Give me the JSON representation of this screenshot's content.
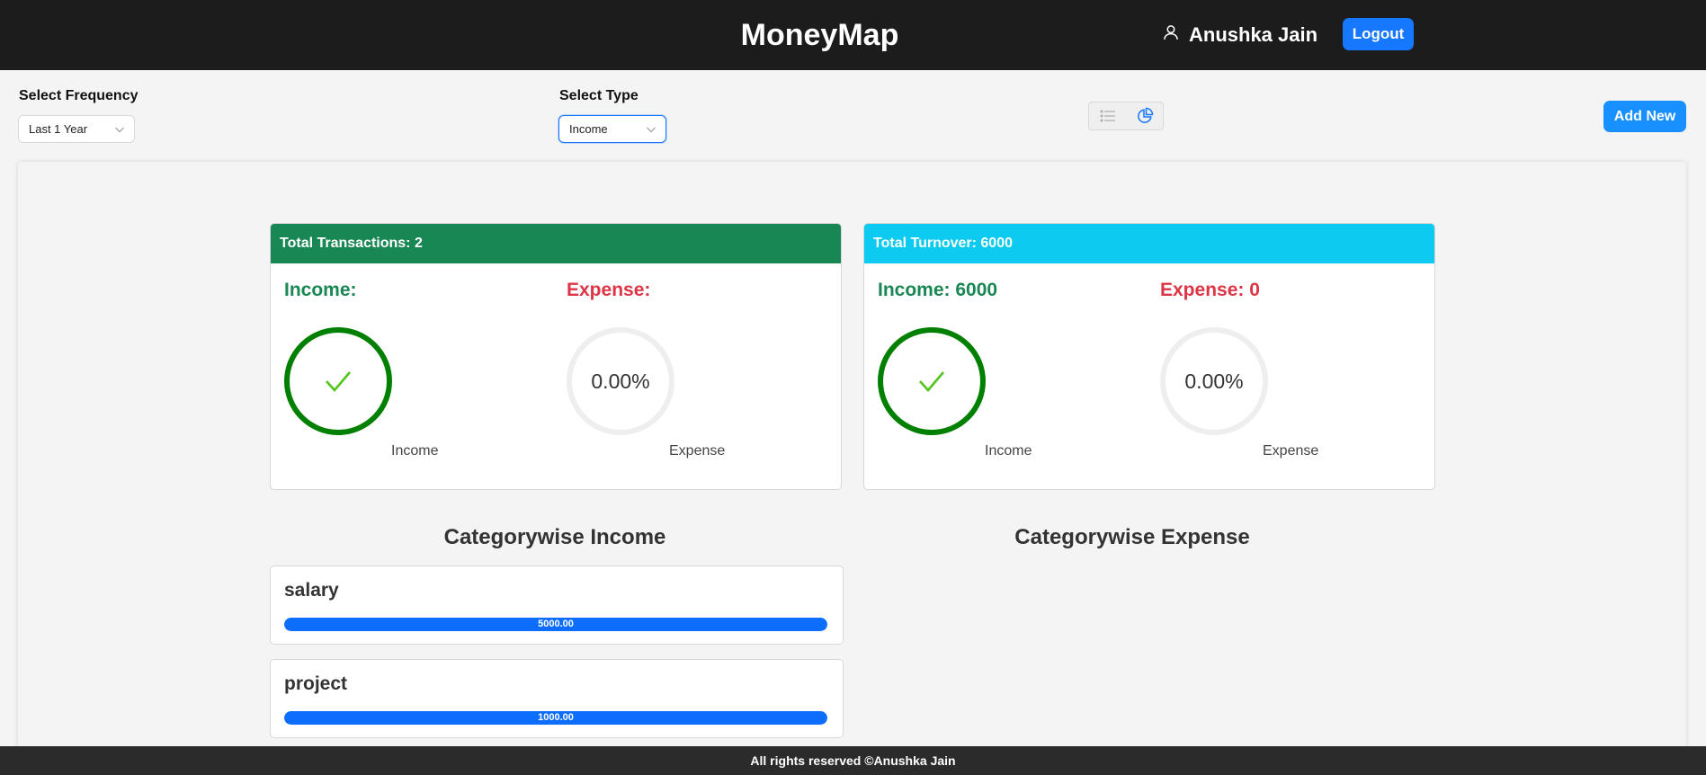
{
  "app": {
    "title": "MoneyMap"
  },
  "header": {
    "user_name": "Anushka Jain",
    "user_icon": "user-icon",
    "logout_label": "Logout"
  },
  "filters": {
    "frequency_label": "Select Frequency",
    "frequency_value": "Last 1 Year",
    "type_label": "Select Type",
    "type_value": "Income",
    "add_new_label": "Add New",
    "view_icons": [
      "list-icon",
      "pie-chart-icon"
    ],
    "active_view": "pie-chart"
  },
  "colors": {
    "header_bg": "#1c1c1c",
    "primary": "#1677ff",
    "transactions_head": "#198754",
    "turnover_head": "#0dcaf0",
    "income_green": "#198754",
    "expense_red": "#dc3545",
    "ring_green": "#008000",
    "bar_blue": "#0d6efd"
  },
  "cards": {
    "transactions": {
      "header": "Total Transactions: 2",
      "income_title": "Income:",
      "expense_title": "Expense:",
      "income_progress_percent": 100,
      "income_label": "Income",
      "expense_percent_text": "0.00%",
      "expense_progress_percent": 0,
      "expense_label": "Expense"
    },
    "turnover": {
      "header": "Total Turnover: 6000",
      "income_title": "Income: 6000",
      "expense_title": "Expense: 0",
      "income_progress_percent": 100,
      "income_label": "Income",
      "expense_percent_text": "0.00%",
      "expense_progress_percent": 0,
      "expense_label": "Expense"
    }
  },
  "categorywise": {
    "income_title": "Categorywise Income",
    "expense_title": "Categorywise Expense",
    "income_items": [
      {
        "name": "salary",
        "value_text": "5000.00",
        "percent": 100
      },
      {
        "name": "project",
        "value_text": "1000.00",
        "percent": 100
      }
    ]
  },
  "footer": {
    "text": "All rights reserved ©Anushka Jain"
  }
}
